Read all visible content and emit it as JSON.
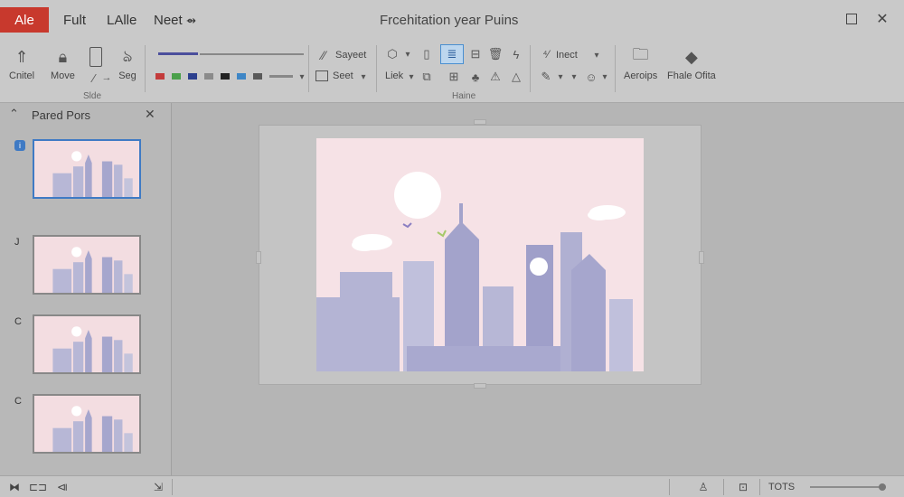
{
  "titlebar": {
    "app_badge": "Ale",
    "menus": [
      "Fult",
      "LAlle",
      "Neet"
    ],
    "document_title": "Frcehitation year Puins"
  },
  "ribbon": {
    "buttons": [
      {
        "label": "Cnitel",
        "icon": "arrow-up-icon"
      },
      {
        "label": "Move",
        "icon": "lock-icon"
      },
      {
        "label": "Seg",
        "icon": "brush-icon"
      }
    ],
    "slide_size_label": "Slde",
    "color_swatches": [
      "#c33b3b",
      "#4aa04a",
      "#2c3f8e",
      "#8b8b8b",
      "#222222",
      "#3e86c6",
      "#5a5a5a",
      "#777777"
    ],
    "format_items": {
      "layout_label": "Sayeet",
      "select_label": "Seet"
    },
    "link_label": "Liek",
    "home_group_label": "Haine",
    "insert_label": "Inect",
    "right_buttons": [
      {
        "label": "Aeroips",
        "icon": "folder-icon"
      },
      {
        "label": "Fhale Ofita",
        "icon": "tag-icon"
      }
    ]
  },
  "panel": {
    "title": "Pared Pors",
    "slides": [
      {
        "number": "i",
        "active": true
      },
      {
        "number": "J",
        "active": false
      },
      {
        "number": "C",
        "active": false
      },
      {
        "number": "C",
        "active": false
      }
    ]
  },
  "statusbar": {
    "zoom_label": "TOTS",
    "zoom_fraction": 0.95
  }
}
